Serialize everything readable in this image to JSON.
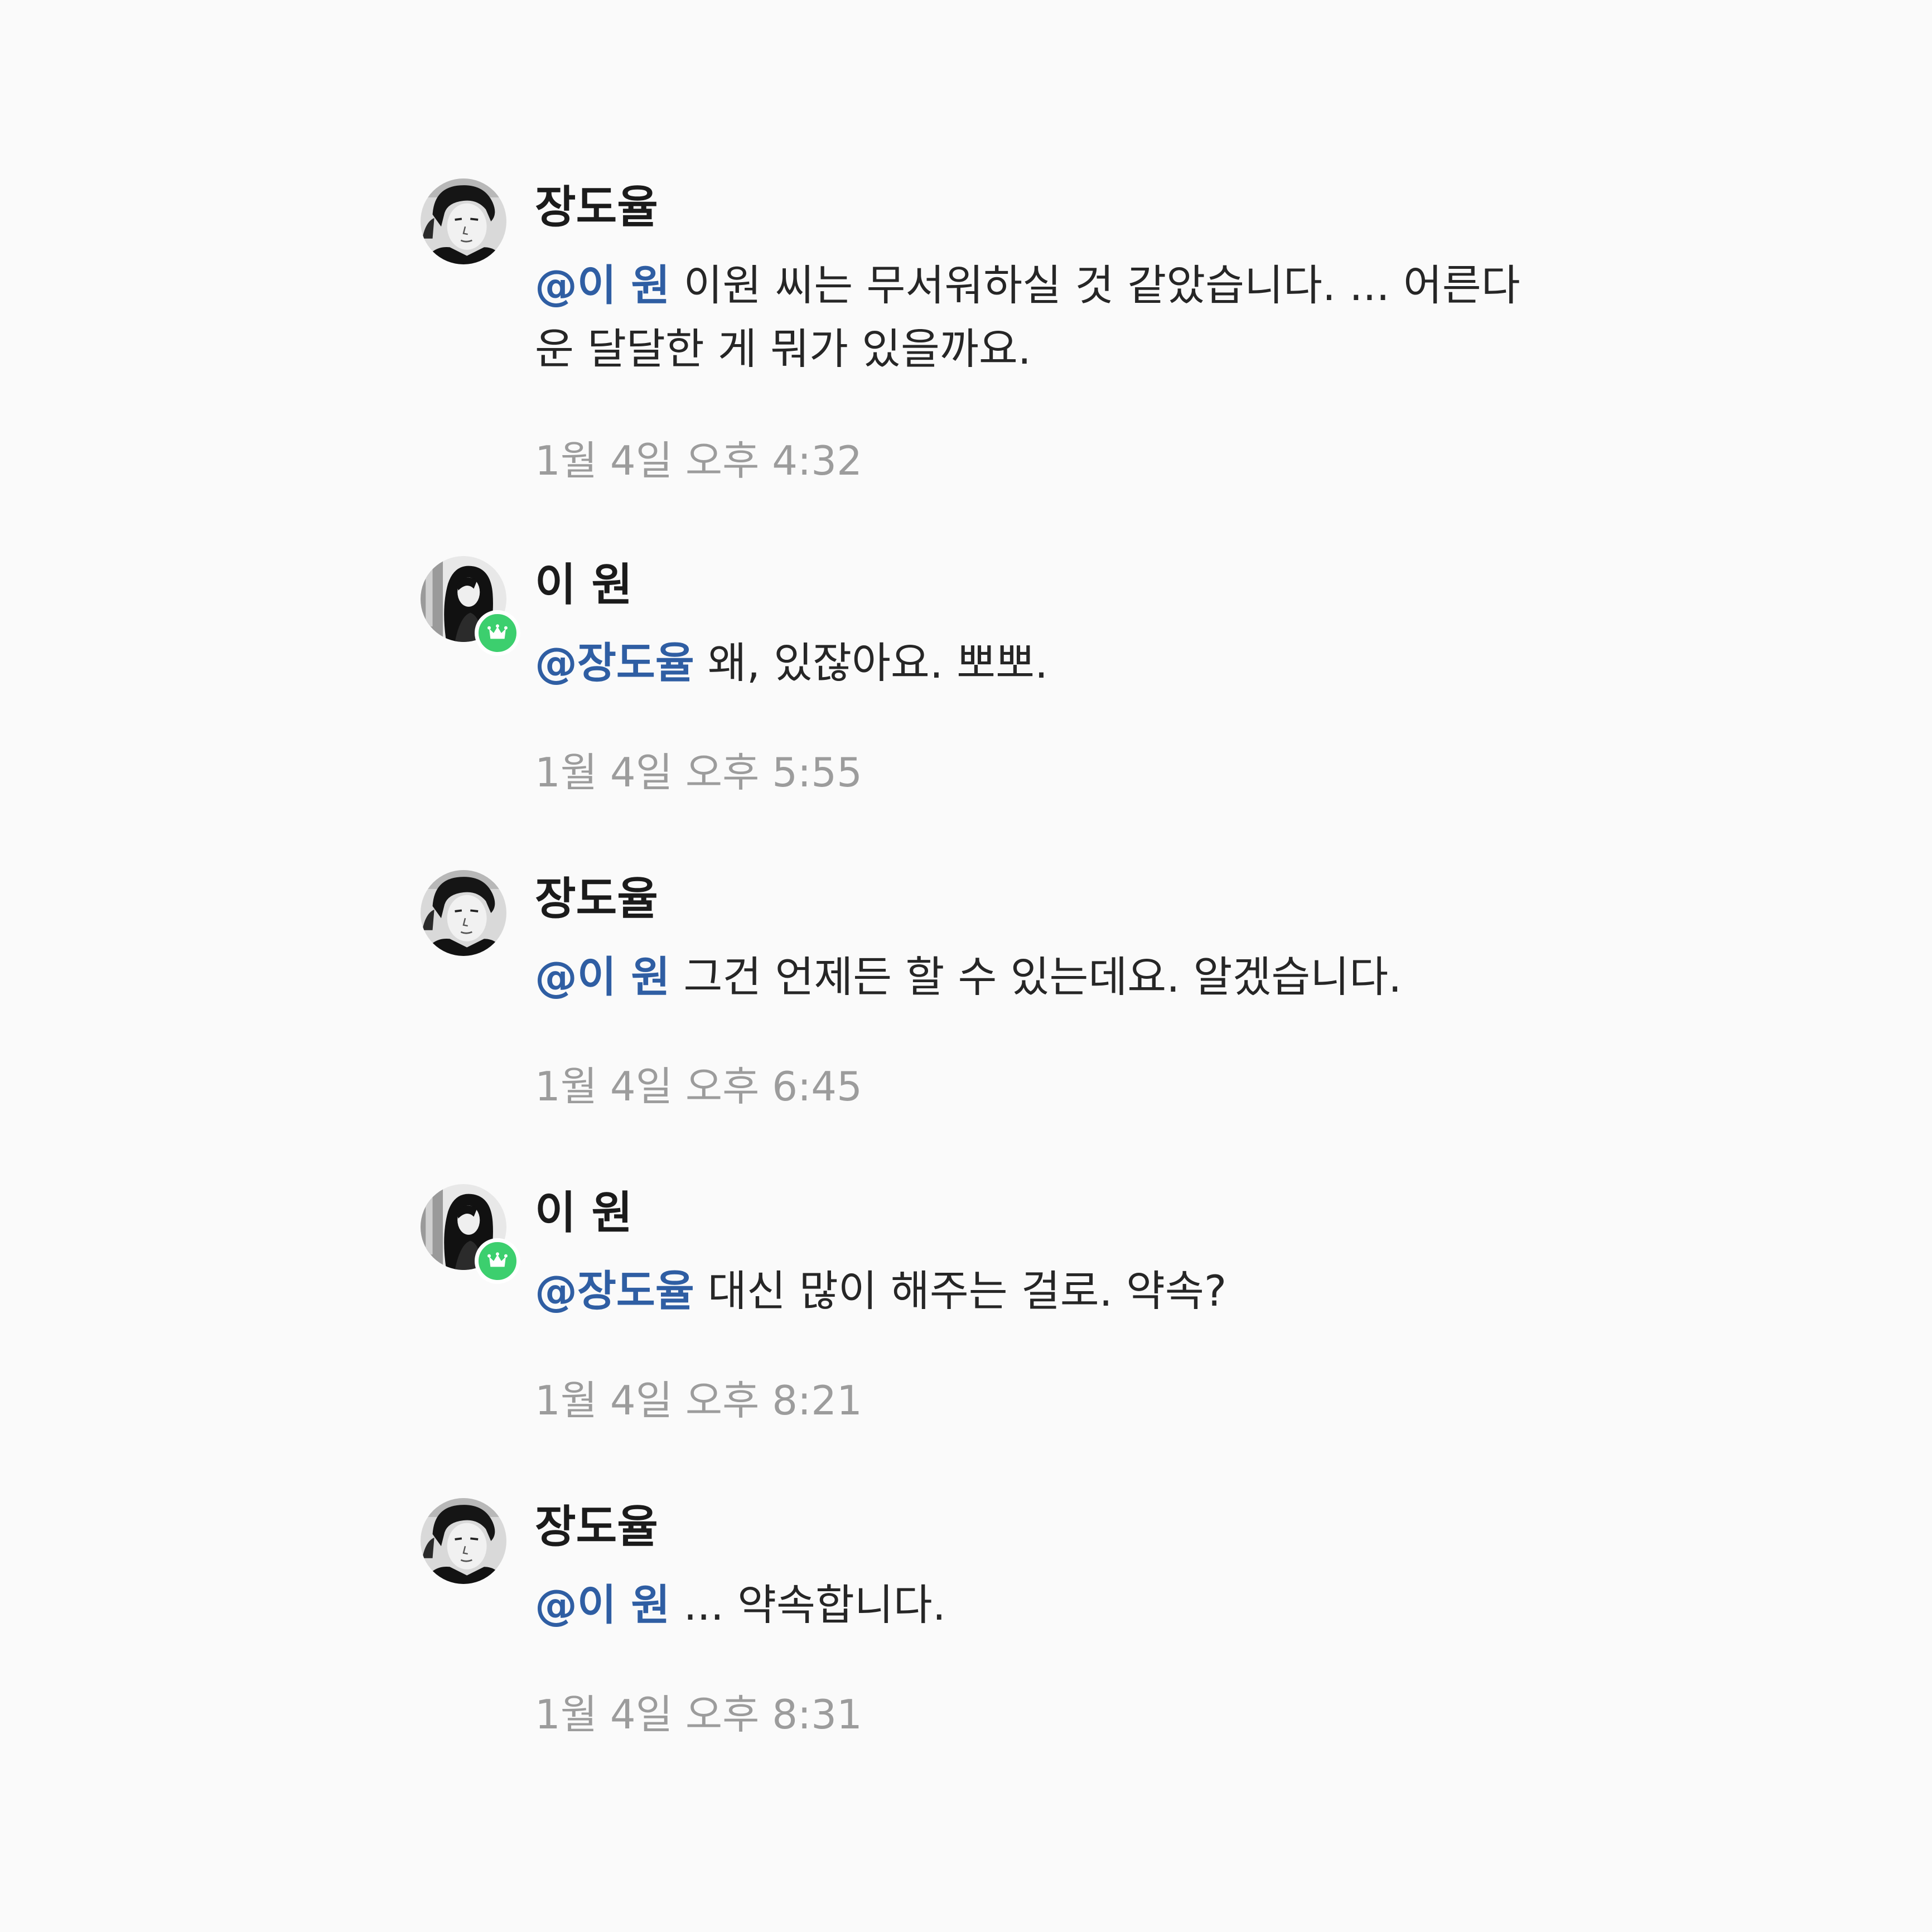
{
  "messages": [
    {
      "author": "장도율",
      "avatar": "man-portrait-avatar",
      "mention": "@이 원",
      "text": " 이원 씨는 무서워하실 것 같았습니다. ... 어른다운 달달한 게 뭐가 있을까요.",
      "time": "1월 4일 오후 4:32"
    },
    {
      "author": "이 원",
      "avatar": "woman-portrait-avatar",
      "badge": "crown-icon",
      "mention": "@장도율",
      "text": " 왜, 있잖아요. 뽀뽀.",
      "time": "1월 4일 오후 5:55"
    },
    {
      "author": "장도율",
      "avatar": "man-portrait-avatar",
      "mention": "@이 원",
      "text": " 그건 언제든 할 수 있는데요. 알겠습니다.",
      "time": "1월 4일 오후 6:45"
    },
    {
      "author": "이 원",
      "avatar": "woman-portrait-avatar",
      "badge": "crown-icon",
      "mention": "@장도율",
      "text": " 대신 많이 해주는 걸로. 약속?",
      "time": "1월 4일 오후 8:21"
    },
    {
      "author": "장도율",
      "avatar": "man-portrait-avatar",
      "mention": "@이 원",
      "text": " ... 약속합니다.",
      "time": "1월 4일 오후 8:31"
    }
  ],
  "colors": {
    "background": "#fafafa",
    "mention": "#2f5ea3",
    "badge": "#3ccf6e",
    "timestamp": "#9c9c9c"
  }
}
